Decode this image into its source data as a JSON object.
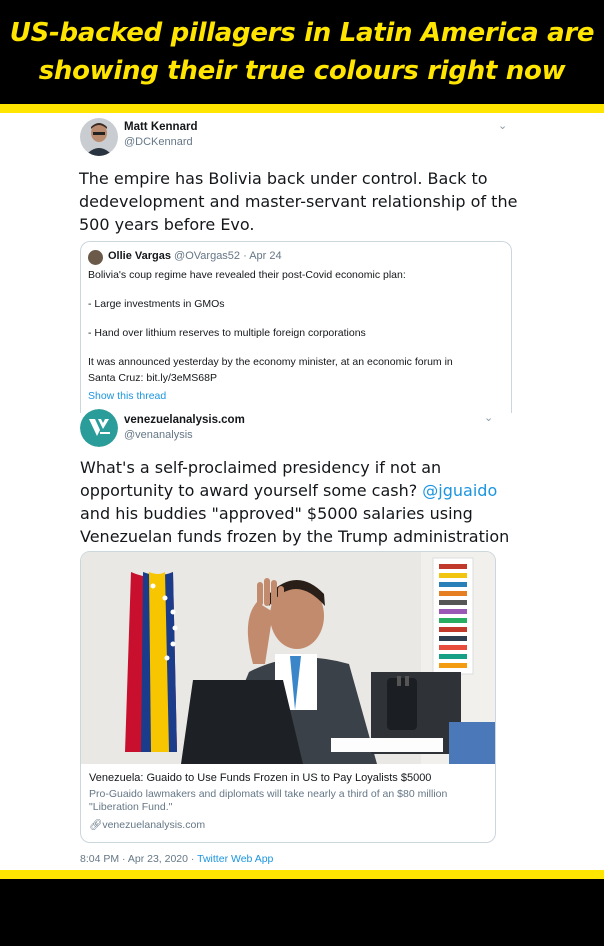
{
  "banner": {
    "line1": "US-backed pillagers in Latin America are",
    "line2": "showing their true colours right now"
  },
  "tweet1": {
    "name": "Matt Kennard",
    "handle": "@DCKennard",
    "text": "The empire has Bolivia back under control. Back to dedevelopment and master-servant relationship of the 500 years before Evo.",
    "quote": {
      "name": "Ollie Vargas",
      "handle": "@OVargas52",
      "date": "· Apr 24",
      "lines": [
        "Bolivia's coup regime have revealed their post-Covid economic plan:",
        "- Large investments in GMOs",
        "- Hand over lithium reserves to multiple foreign corporations",
        "It was announced yesterday by the economy minister, at an economic forum in",
        "Santa Cruz: bit.ly/3eMS68P"
      ],
      "show_thread": "Show this thread"
    }
  },
  "tweet2": {
    "name": "venezuelanalysis.com",
    "handle": "@venanalysis",
    "text_before": "What's a self-proclaimed presidency if not an opportunity to award yourself some cash? ",
    "mention": "@jguaido",
    "text_after": " and his buddies \"approved\" $5000 salaries using Venezuelan funds frozen by the Trump administration",
    "card": {
      "title": "Venezuela: Guaido to Use Funds Frozen in US to Pay Loyalists $5000",
      "description": "Pro-Guaido lawmakers and diplomats will take nearly a third of an $80 million \"Liberation Fund.\"",
      "domain": "venezuelanalysis.com"
    },
    "time": "8:04 PM · Apr 23, 2020 · ",
    "source": "Twitter Web App"
  },
  "colors": {
    "accent_yellow": "#ffe500",
    "link_blue": "#1b95e0",
    "text": "#14171a",
    "muted": "#657786"
  },
  "icons": {
    "chevron": "chevron-down-icon",
    "link": "link-icon",
    "logo": "venezuelanalysis-logo"
  }
}
